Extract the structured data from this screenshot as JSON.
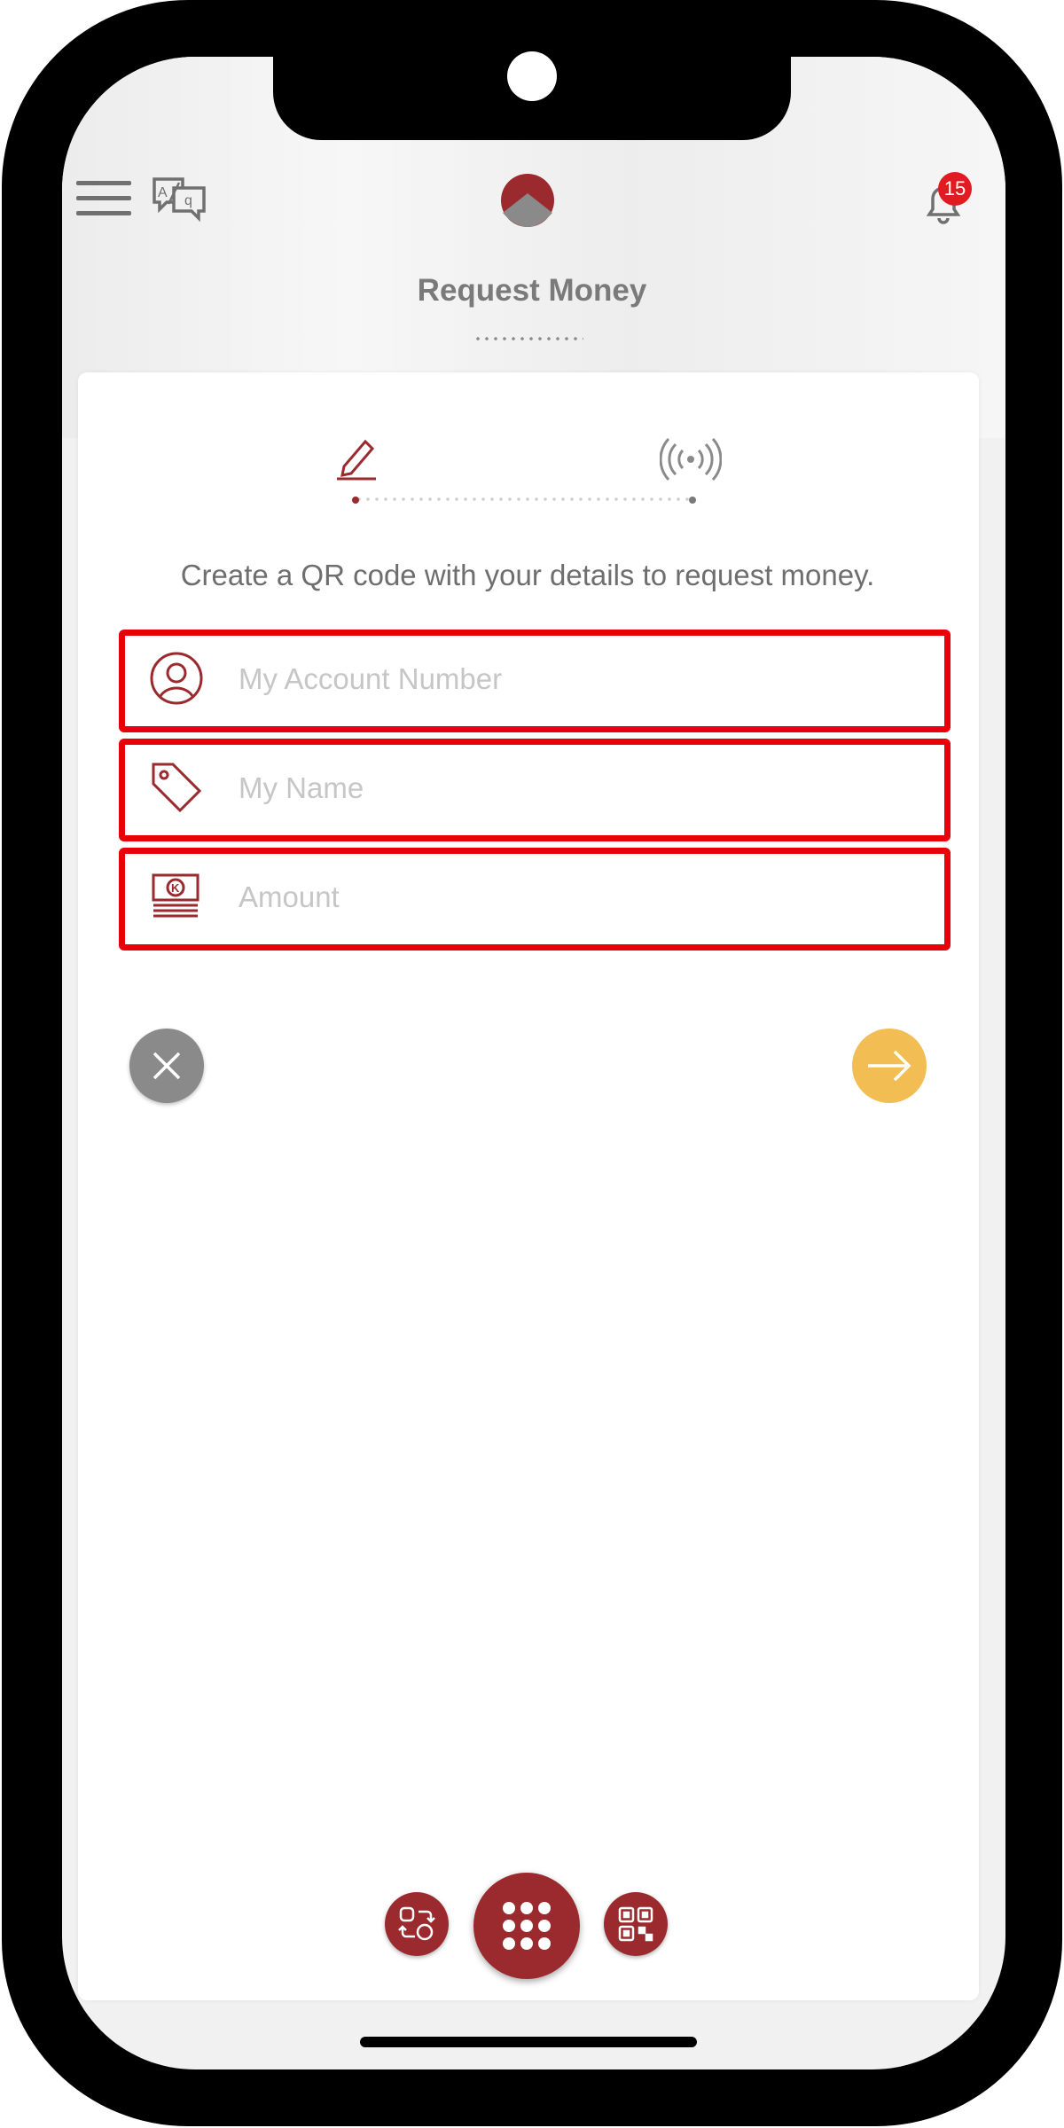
{
  "header": {
    "title": "Request Money",
    "notification_count": "15",
    "icons": {
      "menu": "hamburger-menu-icon",
      "language": "translate-icon",
      "logo": "bank-logo",
      "notifications": "bell-icon"
    }
  },
  "stepper": {
    "steps": [
      "edit-details",
      "broadcast-request"
    ],
    "active_step": 1,
    "active_color": "#9b2a2e",
    "inactive_color": "#7a7a7a"
  },
  "form": {
    "description": "Create a QR code with your details to request money.",
    "account_number": {
      "placeholder": "My Account Number",
      "value": ""
    },
    "name": {
      "placeholder": "My Name",
      "value": ""
    },
    "amount": {
      "placeholder": "Amount",
      "value": ""
    }
  },
  "actions": {
    "cancel_icon": "close-icon",
    "next_icon": "arrow-right-icon",
    "cancel_color": "#8a8a8a",
    "next_color": "#f2bd52"
  },
  "bottom_nav": {
    "items": [
      "transfer-exchange-icon",
      "apps-grid-icon",
      "qr-code-icon"
    ]
  },
  "colors": {
    "brand": "#9b2a2e",
    "highlight": "#e8000a"
  }
}
